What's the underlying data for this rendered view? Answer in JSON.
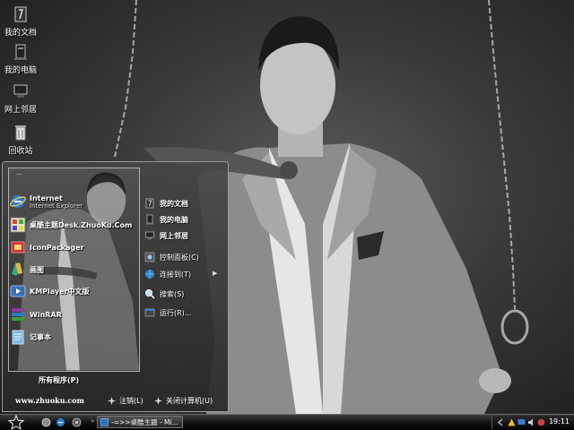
{
  "desktop": {
    "icons": [
      {
        "label": "我的文档",
        "icon": "my-documents-icon"
      },
      {
        "label": "我的电脑",
        "icon": "my-computer-icon"
      },
      {
        "label": "网上邻居",
        "icon": "network-places-icon"
      },
      {
        "label": "回收站",
        "icon": "recycle-bin-icon"
      }
    ]
  },
  "start_menu": {
    "top_mark": "—",
    "programs": [
      {
        "label": "Internet",
        "sublabel": "Internet Explorer",
        "icon": "internet-explorer-icon"
      },
      {
        "label": "桌酷主题Desk.ZhuoKu.Com",
        "icon": "zhuoku-theme-icon"
      },
      {
        "label": "IconPackager",
        "icon": "iconpackager-icon"
      },
      {
        "label": "画图",
        "icon": "paint-icon"
      },
      {
        "label": "KMPlayer中文版",
        "icon": "kmplayer-icon"
      },
      {
        "label": "WinRAR",
        "icon": "winrar-icon"
      },
      {
        "label": "记事本",
        "icon": "notepad-icon"
      }
    ],
    "all_programs": "所有程序(P)",
    "places": [
      {
        "label": "我的文档",
        "icon": "my-documents-icon"
      },
      {
        "label": "我的电脑",
        "icon": "my-computer-icon"
      },
      {
        "label": "网上邻居",
        "icon": "network-places-icon"
      }
    ],
    "system": [
      {
        "label": "控制面板(C)",
        "icon": "control-panel-icon"
      },
      {
        "label": "连接到(T)",
        "icon": "connect-to-icon"
      },
      {
        "label": "搜索(S)",
        "icon": "search-icon"
      },
      {
        "label": "运行(R)...",
        "icon": "run-icon"
      }
    ],
    "site": "www.zhuoku.com",
    "logoff": "注销(L)",
    "shutdown": "关闭计算机(U)"
  },
  "taskbar": {
    "task_label": "-=>>桌酷主题 - Mi...",
    "separator": "»",
    "clock": "19:11"
  },
  "colors": {
    "taskbar": "#000000",
    "menu_border": "#9a9a9a"
  }
}
